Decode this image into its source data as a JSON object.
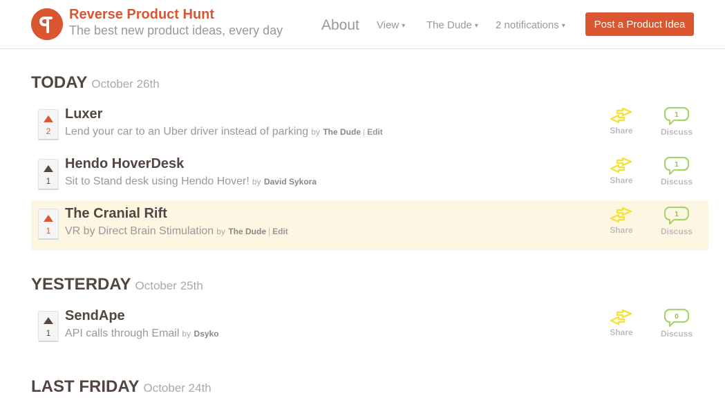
{
  "header": {
    "brand_title": "Reverse Product Hunt",
    "brand_tagline": "The best new product ideas, every day",
    "nav": {
      "about": "About",
      "view": "View",
      "user": "The Dude",
      "notifications": "2 notifications",
      "caret": "▾"
    },
    "post_button": "Post a Product Idea"
  },
  "colors": {
    "brand": "#da5630",
    "highlight_row": "#fdf6e3",
    "share_icon": "#f2e43a",
    "discuss_icon": "#a5d46a"
  },
  "icons": [
    "logo-p-icon",
    "upvote-arrow-icon",
    "share-arrows-icon",
    "speech-bubble-icon"
  ],
  "days": [
    {
      "label": "TODAY",
      "date": "October 26th",
      "posts": [
        {
          "votes": "2",
          "voted": true,
          "name": "Luxer",
          "description": "Lend your car to an Uber driver instead of parking",
          "by": "by",
          "author": "The Dude",
          "editable": true,
          "edit_label": "Edit",
          "share_label": "Share",
          "comments": "1",
          "discuss_label": "Discuss",
          "highlighted": false
        },
        {
          "votes": "1",
          "voted": false,
          "name": "Hendo HoverDesk",
          "description": "Sit to Stand desk using Hendo Hover!",
          "by": "by",
          "author": "David Sykora",
          "editable": false,
          "share_label": "Share",
          "comments": "1",
          "discuss_label": "Discuss",
          "highlighted": false
        },
        {
          "votes": "1",
          "voted": true,
          "name": "The Cranial Rift",
          "description": "VR by Direct Brain Stimulation",
          "by": "by",
          "author": "The Dude",
          "editable": true,
          "edit_label": "Edit",
          "share_label": "Share",
          "comments": "1",
          "discuss_label": "Discuss",
          "highlighted": true
        }
      ]
    },
    {
      "label": "YESTERDAY",
      "date": "October 25th",
      "posts": [
        {
          "votes": "1",
          "voted": false,
          "name": "SendApe",
          "description": "API calls through Email",
          "by": "by",
          "author": "Dsyko",
          "editable": false,
          "share_label": "Share",
          "comments": "0",
          "discuss_label": "Discuss",
          "highlighted": false
        }
      ]
    },
    {
      "label": "LAST FRIDAY",
      "date": "October 24th",
      "posts": []
    }
  ]
}
